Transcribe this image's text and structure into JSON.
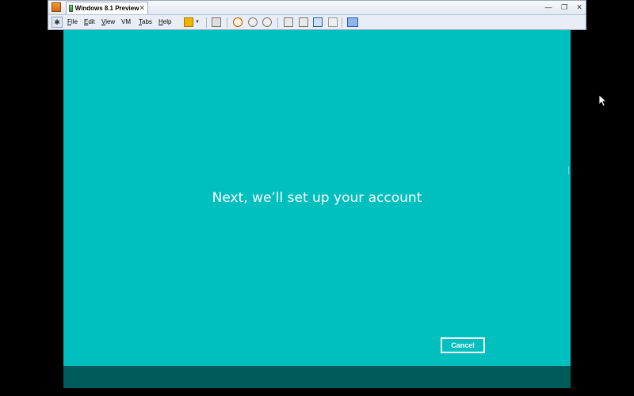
{
  "window": {
    "tab_title": "Windows 8.1 Preview",
    "tab_close": "✕",
    "minimize": "—",
    "restore": "❐",
    "close": "✕"
  },
  "menubar": {
    "file": "File",
    "edit": "Edit",
    "view": "View",
    "vm": "VM",
    "tabs": "Tabs",
    "help": "Help"
  },
  "guest": {
    "message": "Next, we’ll set up your account",
    "cancel_label": "Cancel",
    "background_color": "#00bfbf",
    "band_color": "#005b5b"
  }
}
